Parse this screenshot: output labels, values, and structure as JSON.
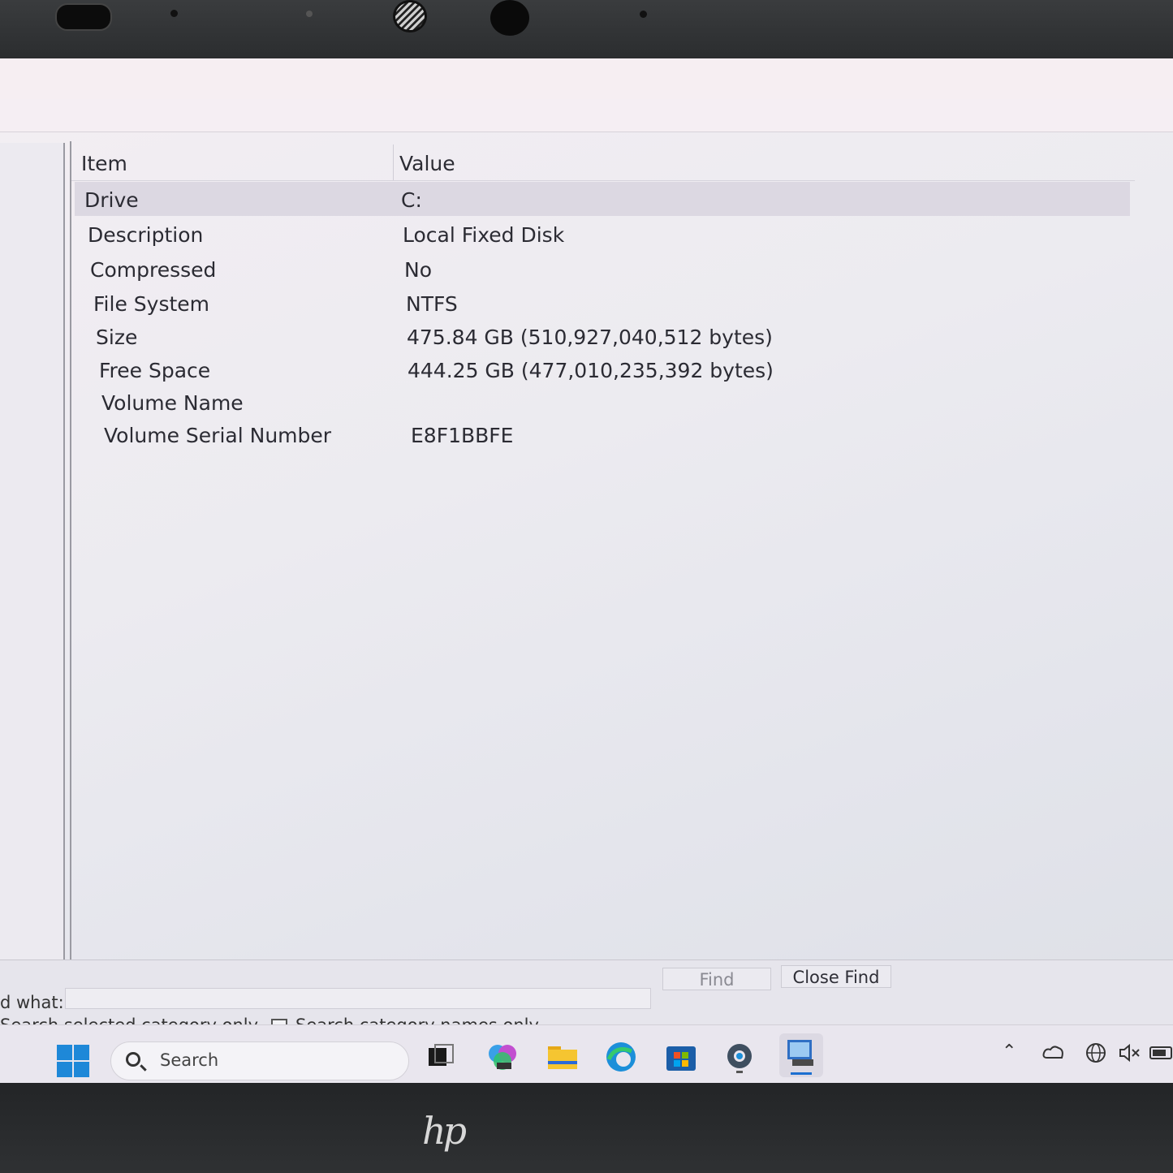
{
  "hardware": {
    "brand_logo": "hp"
  },
  "table": {
    "columns": {
      "item": "Item",
      "value": "Value"
    },
    "rows": [
      {
        "item": "Drive",
        "value": "C:"
      },
      {
        "item": "Description",
        "value": "Local Fixed Disk"
      },
      {
        "item": "Compressed",
        "value": "No"
      },
      {
        "item": "File System",
        "value": "NTFS"
      },
      {
        "item": "Size",
        "value": "475.84 GB (510,927,040,512 bytes)"
      },
      {
        "item": "Free Space",
        "value": "444.25 GB (477,010,235,392 bytes)"
      },
      {
        "item": "Volume Name",
        "value": ""
      },
      {
        "item": "Volume Serial Number",
        "value": "E8F1BBFE"
      }
    ]
  },
  "find": {
    "label": "d what:",
    "value": "",
    "find_button": "Find",
    "close_button": "Close Find",
    "opt_selected_category": "Search selected category only",
    "opt_category_names": "Search category names only"
  },
  "taskbar": {
    "search_placeholder": "Search",
    "icons": [
      "task-view-icon",
      "copilot-icon",
      "file-explorer-icon",
      "edge-icon",
      "store-icon",
      "settings-icon",
      "system-information-icon"
    ],
    "tray": [
      "chevron-up-icon",
      "cloud-icon",
      "network-icon",
      "volume-muted-icon",
      "battery-icon"
    ]
  },
  "colors": {
    "accent": "#1e88d8",
    "selected_row": "#dcd8e2"
  }
}
